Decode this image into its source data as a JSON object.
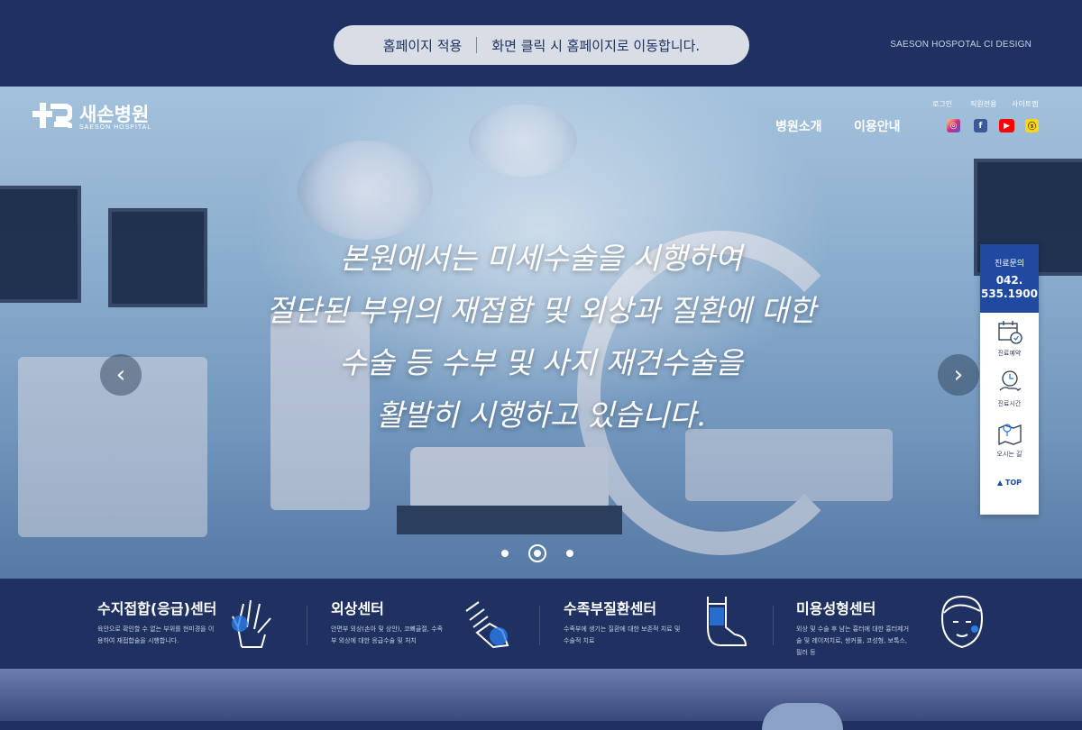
{
  "top_banner": {
    "apply_label": "홈페이지 적용",
    "notice": "화면 클릭 시 홈페이지로 이동합니다.",
    "ci_label": "SAESON HOSPOTAL CI DESIGN"
  },
  "logo": {
    "name_ko": "새손병원",
    "name_en": "SAESON HOSPITAL"
  },
  "nav": {
    "items": [
      {
        "label": "병원소개"
      },
      {
        "label": "이용안내"
      }
    ]
  },
  "util": {
    "items": [
      {
        "label": "로그인"
      },
      {
        "label": "직원전용"
      },
      {
        "label": "사이트맵"
      }
    ]
  },
  "social": [
    {
      "icon": "instagram-icon",
      "color": "#d62976"
    },
    {
      "icon": "facebook-icon",
      "color": "#3b5998"
    },
    {
      "icon": "youtube-icon",
      "color": "#ff0000"
    },
    {
      "icon": "kakaostory-icon",
      "color": "#f9d71c"
    }
  ],
  "hero": {
    "lines": [
      "본원에서는 미세수술을 시행하여",
      "절단된 부위의 재접합 및 외상과 질환에 대한",
      "수술 등 수부 및 사지 재건수술을",
      "활발히 시행하고 있습니다."
    ],
    "prev": "‹",
    "next": "›",
    "slides": 3,
    "active_slide": 2
  },
  "quick": {
    "call_title": "진료문의",
    "call_number_1": "042.",
    "call_number_2": "535.1900",
    "items": [
      {
        "label": "진료예약"
      },
      {
        "label": "진료시간"
      },
      {
        "label": "오시는 길"
      }
    ],
    "top_label": "▲ TOP"
  },
  "centers": [
    {
      "title": "수지접합(응급)센터",
      "desc": "육안으로 확인할 수 없는 부위를 현미경을 이용하여 재접합술을 시행합니다."
    },
    {
      "title": "외상센터",
      "desc": "안면부 외상(손아 및 상안), 코뼈골절, 수족부 외상에 대한 응급수술 및 처치"
    },
    {
      "title": "수족부질환센터",
      "desc": "수족부에 생기는 질환에 대한 보존적 치료 및 수술적 치료"
    },
    {
      "title": "미용성형센터",
      "desc": "외상 및 수술 후 남는 흉터에 대한 흉터제거술 및 레이저치료, 쌍커풀, 코성형, 보톡스, 필러 등"
    }
  ],
  "colors": {
    "navy": "#1f3160",
    "quick_blue": "#1f4aa0",
    "accent_blue": "#2b7de9"
  }
}
